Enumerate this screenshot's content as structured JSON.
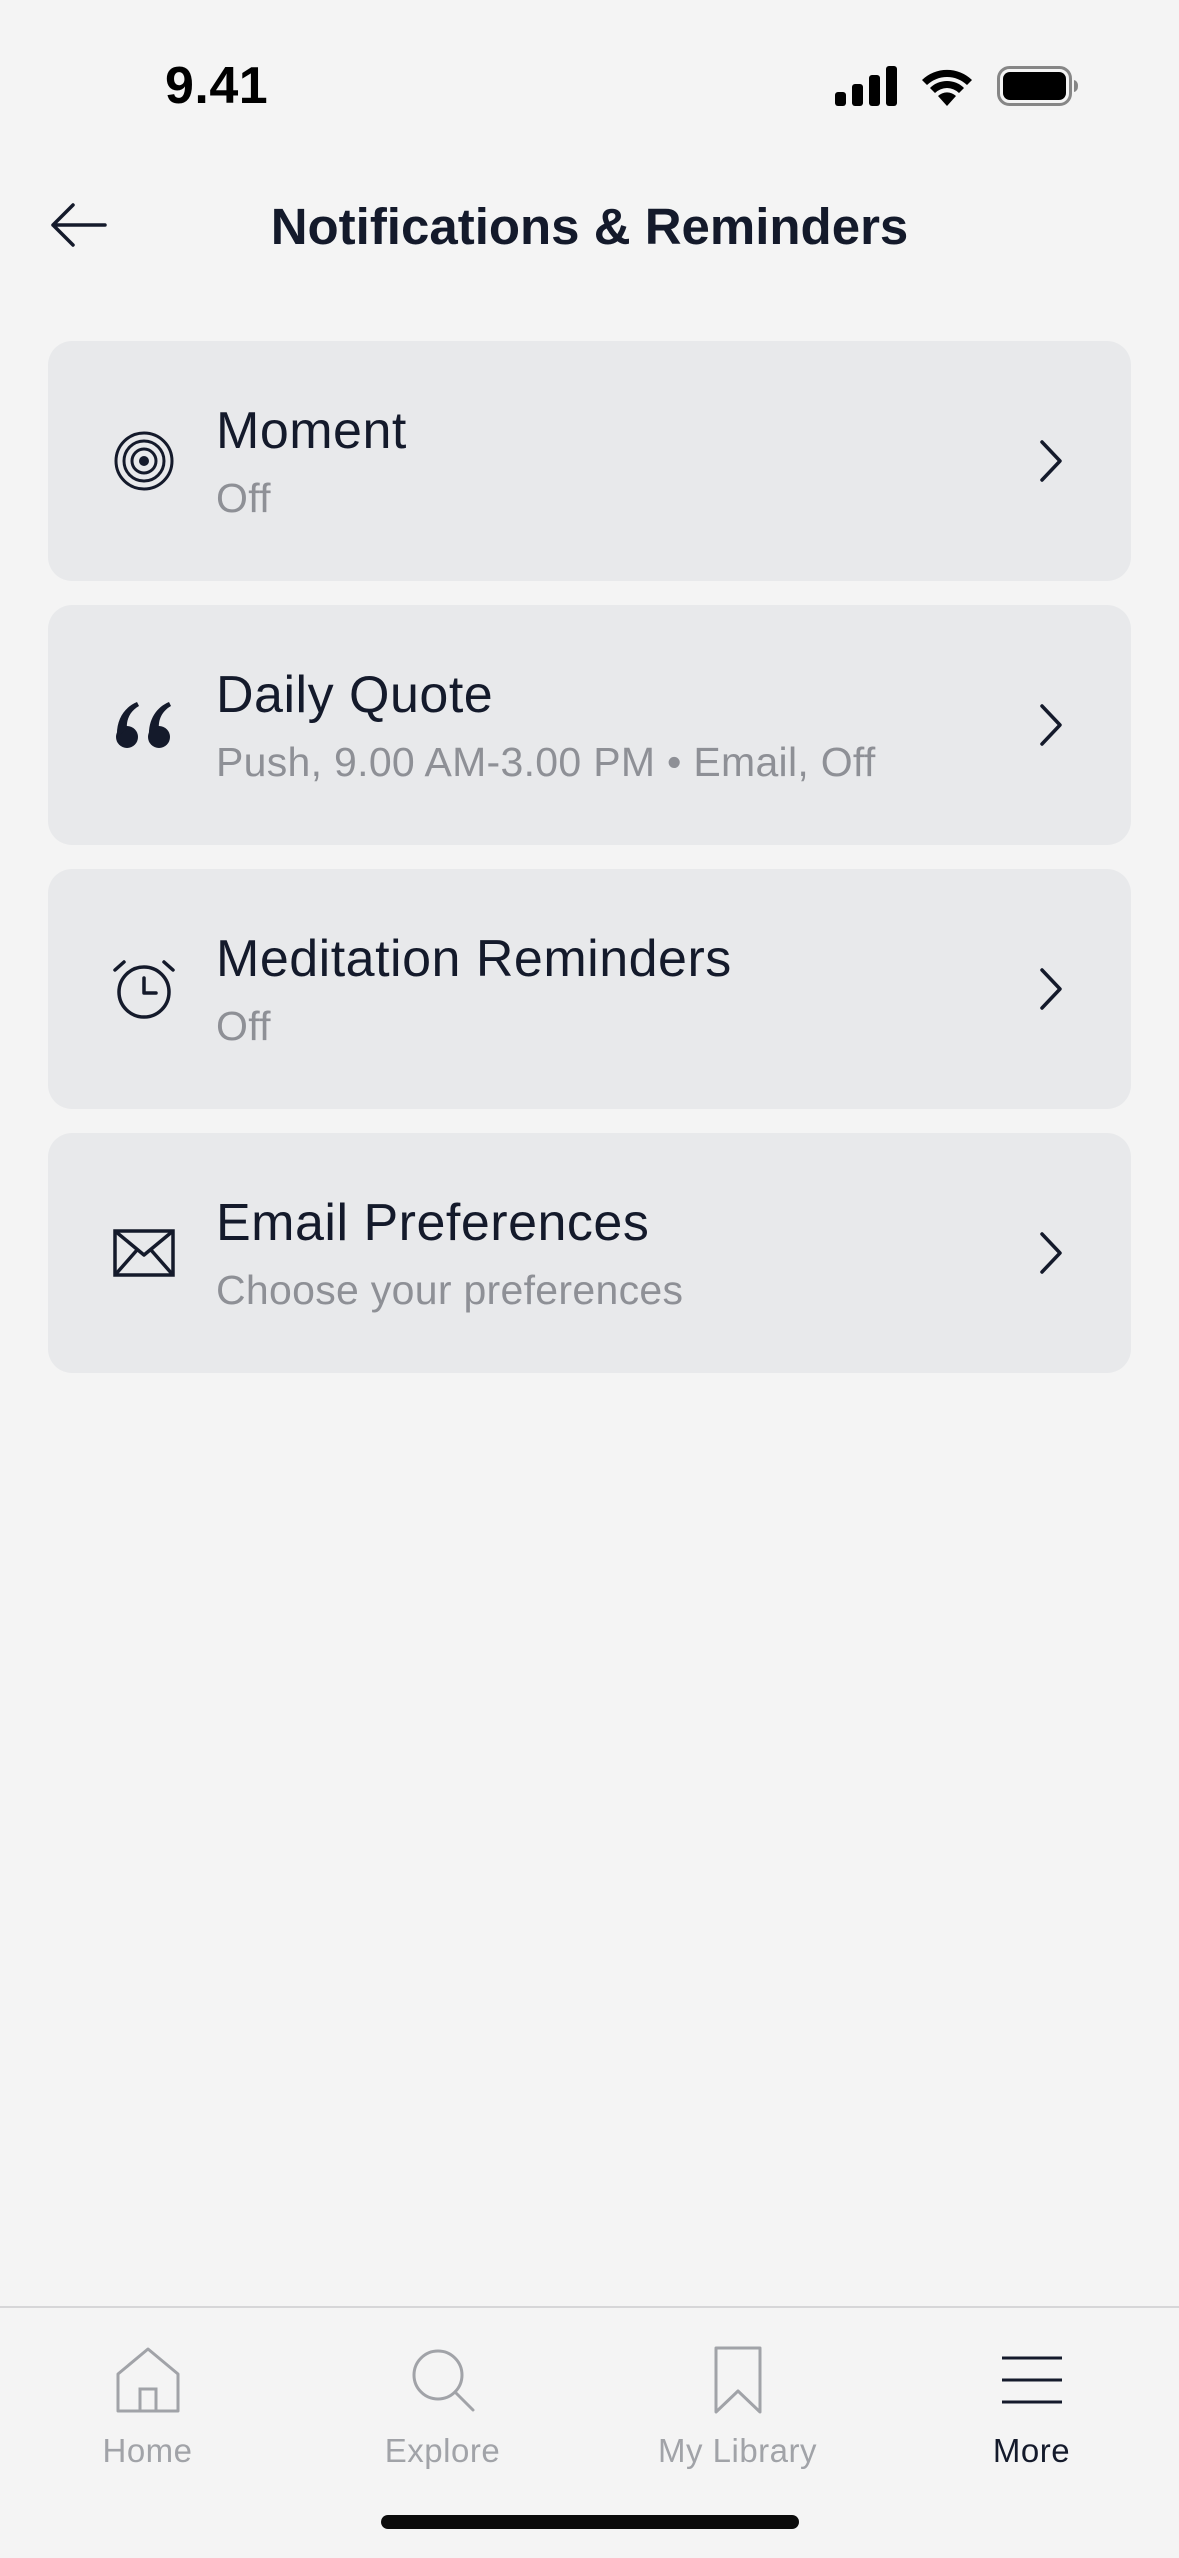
{
  "status_bar": {
    "time": "9.41"
  },
  "header": {
    "title": "Notifications & Reminders"
  },
  "items": [
    {
      "icon": "target-icon",
      "title": "Moment",
      "subtitle": "Off"
    },
    {
      "icon": "quote-icon",
      "title": "Daily Quote",
      "subtitle": "Push, 9.00 AM-3.00 PM • Email, Off"
    },
    {
      "icon": "alarm-clock-icon",
      "title": "Meditation Reminders",
      "subtitle": "Off"
    },
    {
      "icon": "envelope-icon",
      "title": "Email Preferences",
      "subtitle": "Choose your preferences"
    }
  ],
  "tabbar": {
    "tabs": [
      {
        "label": "Home",
        "icon": "home-icon",
        "active": false
      },
      {
        "label": "Explore",
        "icon": "search-icon",
        "active": false
      },
      {
        "label": "My Library",
        "icon": "bookmark-icon",
        "active": false
      },
      {
        "label": "More",
        "icon": "menu-icon",
        "active": true
      }
    ]
  },
  "colors": {
    "background": "#f4f4f4",
    "card": "#e8e9eb",
    "text_primary": "#141a2b",
    "text_secondary": "#8e9096",
    "tab_inactive": "#a1a3a8"
  }
}
